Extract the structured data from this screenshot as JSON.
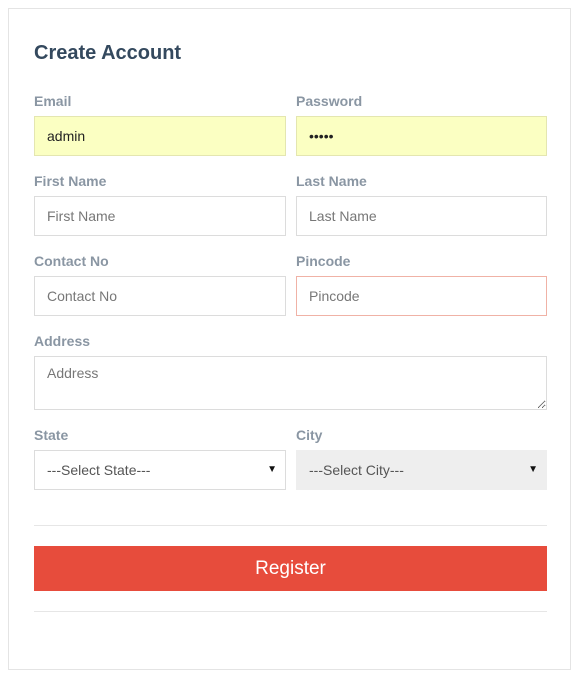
{
  "form": {
    "title": "Create Account",
    "email": {
      "label": "Email",
      "value": "admin"
    },
    "password": {
      "label": "Password",
      "value": "•••••"
    },
    "first_name": {
      "label": "First Name",
      "placeholder": "First Name"
    },
    "last_name": {
      "label": "Last Name",
      "placeholder": "Last Name"
    },
    "contact_no": {
      "label": "Contact No",
      "placeholder": "Contact No"
    },
    "pincode": {
      "label": "Pincode",
      "placeholder": "Pincode"
    },
    "address": {
      "label": "Address",
      "placeholder": "Address"
    },
    "state": {
      "label": "State",
      "selected": "---Select State---"
    },
    "city": {
      "label": "City",
      "selected": "---Select City---"
    },
    "register_label": "Register"
  },
  "colors": {
    "accent": "#e74c3c",
    "autofill": "#fbffc2",
    "title": "#34495e",
    "label": "#8a96a3"
  }
}
